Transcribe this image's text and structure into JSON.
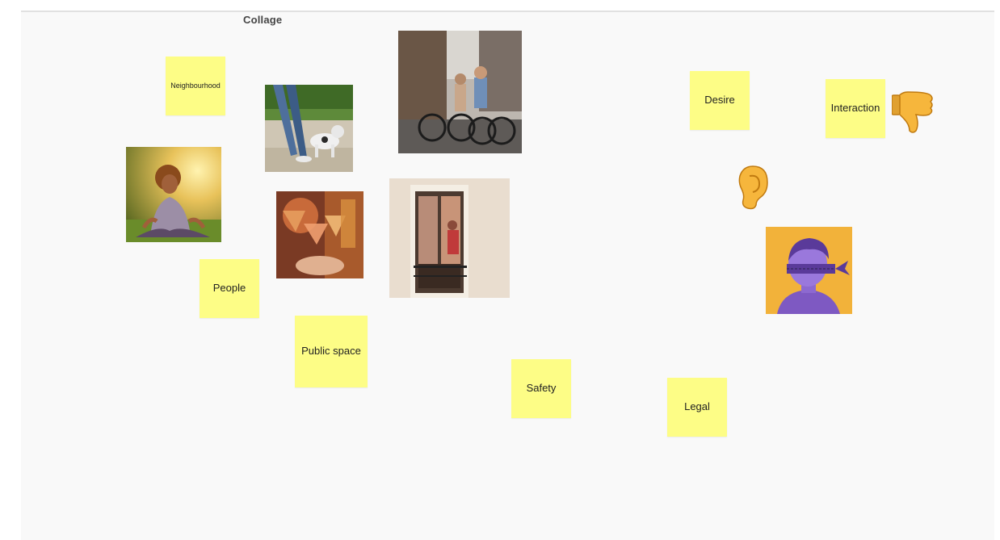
{
  "board": {
    "frame_title": "Collage"
  },
  "stickies": {
    "neighbourhood": "Neighbourhood",
    "people": "People",
    "public_space": "Public space",
    "safety": "Safety",
    "desire": "Desire",
    "interaction": "Interaction",
    "legal": "Legal"
  },
  "images": {
    "meditating_woman": "meditating-woman-photo",
    "dog_walk": "dog-walk-photo",
    "cyclists": "cyclists-photo",
    "toast": "toast-photo",
    "window": "window-photo",
    "blindfold": "blindfolded-figure-illustration"
  },
  "icons": {
    "thumbs_down": "thumbs-down-icon",
    "ear": "ear-icon"
  },
  "colors": {
    "sticky": "#fdfd86",
    "board": "#f9f9f9"
  }
}
